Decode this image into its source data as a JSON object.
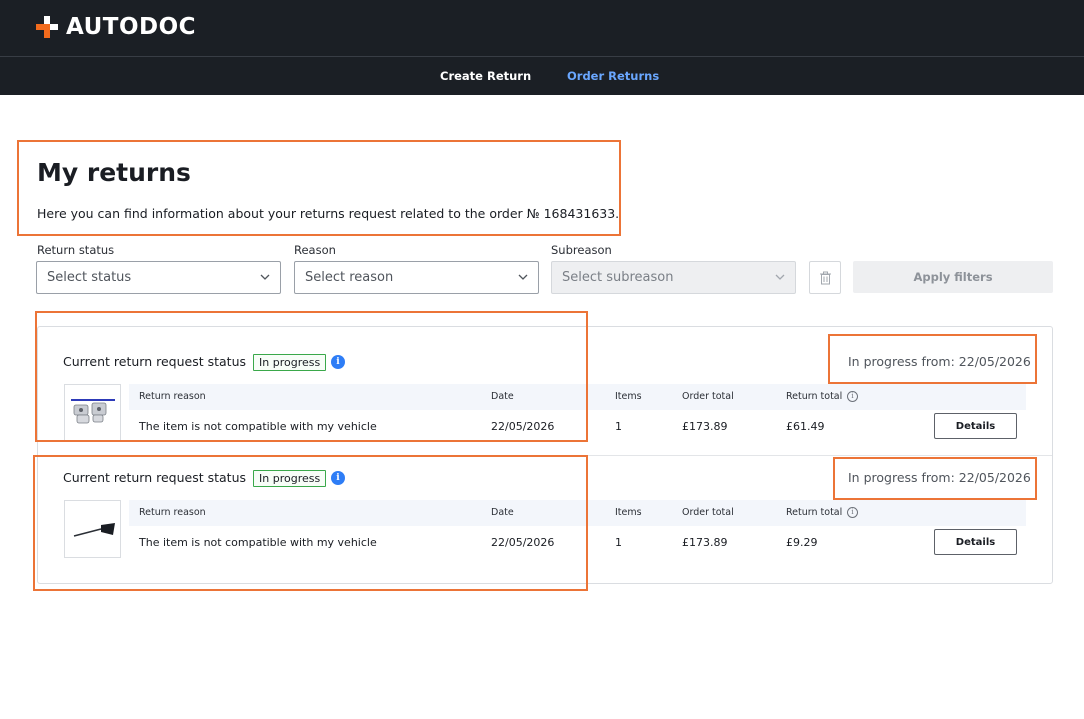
{
  "header": {
    "logo_text": "AUTODOC",
    "nav": [
      {
        "label": "Create Return"
      },
      {
        "label": "Order Returns"
      }
    ],
    "active_nav": "Order Returns",
    "accent_color": "#f26b1d",
    "active_color": "#6aa7ff"
  },
  "page": {
    "title": "My returns",
    "subtitle": "Here you can find information about your returns request related to the order № 168431633."
  },
  "filters": {
    "status": {
      "label": "Return status",
      "placeholder": "Select status"
    },
    "reason": {
      "label": "Reason",
      "placeholder": "Select reason"
    },
    "subreason": {
      "label": "Subreason",
      "placeholder": "Select subreason"
    },
    "apply_label": "Apply filters"
  },
  "columns": {
    "reason": "Return reason",
    "date": "Date",
    "items": "Items",
    "order_total": "Order total",
    "return_total": "Return total"
  },
  "returns": [
    {
      "status_label": "Current return request status",
      "badge": "In progress",
      "progress_from": "In progress from: 22/05/2026",
      "reason": "The item is not compatible with my vehicle",
      "date": "22/05/2026",
      "items": "1",
      "order_total": "£173.89",
      "return_total": "£61.49",
      "details_label": "Details"
    },
    {
      "status_label": "Current return request status",
      "badge": "In progress",
      "progress_from": "In progress from: 22/05/2026",
      "reason": "The item is not compatible with my vehicle",
      "date": "22/05/2026",
      "items": "1",
      "order_total": "£173.89",
      "return_total": "£9.29",
      "details_label": "Details"
    }
  ]
}
